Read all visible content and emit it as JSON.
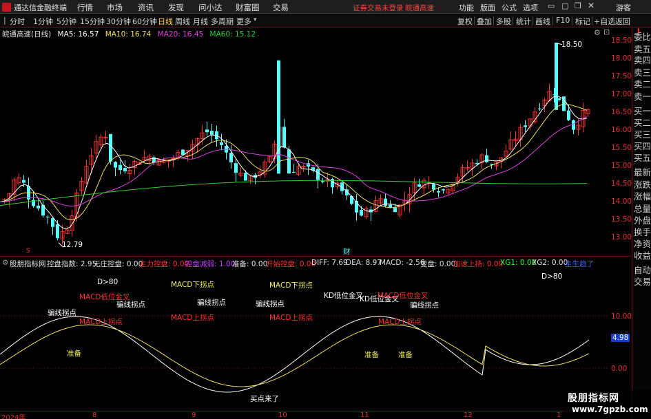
{
  "titlebar": {
    "app_title": "通达信金融终端",
    "menus": [
      "行情",
      "市场",
      "资讯",
      "发现",
      "问小达",
      "财富圈",
      "交易"
    ],
    "warning": "证券交易未登录",
    "stock_name": "皖通高速",
    "right_menus": [
      "功能",
      "版面",
      "公式",
      "选项"
    ],
    "guest": "游客"
  },
  "toolbar": {
    "periods": [
      "分时",
      "1分钟",
      "5分钟",
      "15分钟",
      "30分钟",
      "60分钟",
      "日线",
      "周线",
      "月线",
      "多周期",
      "更多"
    ],
    "selected": "日线",
    "right_items": [
      "复权",
      "叠加",
      "多股",
      "统计",
      "画线",
      "F10",
      "标记",
      "+自选",
      "返回"
    ]
  },
  "chart_header": {
    "stock_label": "皖通高速(日线)",
    "ma5": "MA5: 16.57",
    "ma10": "MA10: 16.74",
    "ma20": "MA20: 16.45",
    "ma60": "MA60: 15.12"
  },
  "colors": {
    "up": "#ff3030",
    "down": "#54ffff",
    "ma5": "#ffffff",
    "ma10": "#f0e060",
    "ma20": "#e040e0",
    "ma60": "#30d030",
    "axis": "#e03030"
  },
  "price_axis": [
    "18.50",
    "18.00",
    "17.50",
    "17.00",
    "16.50",
    "16.00",
    "15.50",
    "15.00",
    "14.50",
    "14.00",
    "13.50",
    "13.00"
  ],
  "price_annotations": {
    "high": "18.50",
    "low": "12.79",
    "marker_s": "S",
    "marker_cai": "财"
  },
  "right_panel": [
    "委比",
    "卖五",
    "卖四",
    "卖三",
    "卖二",
    "卖一",
    "买一",
    "买二",
    "买三",
    "买四",
    "买五",
    "最新",
    "涨跌",
    "涨幅",
    "总量",
    "外盘",
    "换手",
    "净资",
    "收益",
    "自动",
    "交易"
  ],
  "indicator_header": {
    "name": "股朋指标网",
    "items": [
      {
        "text": "控盘指数: 2.95",
        "color": "#e0e0e0"
      },
      {
        "text": "无庄控盘: 0.00",
        "color": "#e0e0e0"
      },
      {
        "text": "主力控盘: 0.00",
        "color": "#ff3030"
      },
      {
        "text": "控盘减弱: 1.00",
        "color": "#c040ff"
      },
      {
        "text": "准备: 0.00",
        "color": "#e0e0e0"
      },
      {
        "text": "开始控盘: 0.00",
        "color": "#ff3030"
      },
      {
        "text": "DIFF: 7.69",
        "color": "#e0e0e0"
      },
      {
        "text": "DEA: 8.97",
        "color": "#e0e0e0"
      },
      {
        "text": "MACD: -2.56",
        "color": "#e0e0e0"
      },
      {
        "text": "变盘: 0.00",
        "color": "#e0e0e0"
      },
      {
        "text": "加速上扬: 0.00",
        "color": "#ff3030"
      },
      {
        "text": "XG1: 0.00",
        "color": "#30ff30"
      },
      {
        "text": "XG2: 0.00",
        "color": "#e0e0e0"
      },
      {
        "text": "主生趋了",
        "color": "#4060ff"
      }
    ]
  },
  "indicator_axis": [
    "10.00",
    "5.00",
    "4.98",
    "0.00"
  ],
  "indicator_annotations": [
    {
      "text": "D>80",
      "color": "#ffffff"
    },
    {
      "text": "MACD低位金叉",
      "color": "#ff3030"
    },
    {
      "text": "MACD下拐点",
      "color": "#f0f060"
    },
    {
      "text": "MACD下拐点",
      "color": "#f0f060"
    },
    {
      "text": "KD低位金叉",
      "color": "#ffffff"
    },
    {
      "text": "KD低位金叉",
      "color": "#ffffff"
    },
    {
      "text": "MACD低位金叉",
      "color": "#ff3030"
    },
    {
      "text": "D>80",
      "color": "#ffffff"
    },
    {
      "text": "骗线拐点",
      "color": "#ffffff"
    },
    {
      "text": "骗线拐点",
      "color": "#ffffff"
    },
    {
      "text": "骗线拐点",
      "color": "#ffffff"
    },
    {
      "text": "骗线拐点",
      "color": "#ffffff"
    },
    {
      "text": "骗线拐点",
      "color": "#ffffff"
    },
    {
      "text": "MACD上拐点",
      "color": "#ff3030"
    },
    {
      "text": "MACD上拐点",
      "color": "#ff3030"
    },
    {
      "text": "MACD上拐点",
      "color": "#ff3030"
    },
    {
      "text": "MACD上拐点",
      "color": "#ff3030"
    },
    {
      "text": "准备",
      "color": "#f0f060"
    },
    {
      "text": "准备",
      "color": "#f0f060"
    },
    {
      "text": "准备",
      "color": "#f0f060"
    },
    {
      "text": "买点来了",
      "color": "#ffffff"
    }
  ],
  "time_axis": [
    "2024年",
    "8",
    "9",
    "10",
    "11",
    "12",
    "1"
  ],
  "watermark": {
    "line1": "股朋指标网",
    "line2": "www.7gpzb.com"
  }
}
